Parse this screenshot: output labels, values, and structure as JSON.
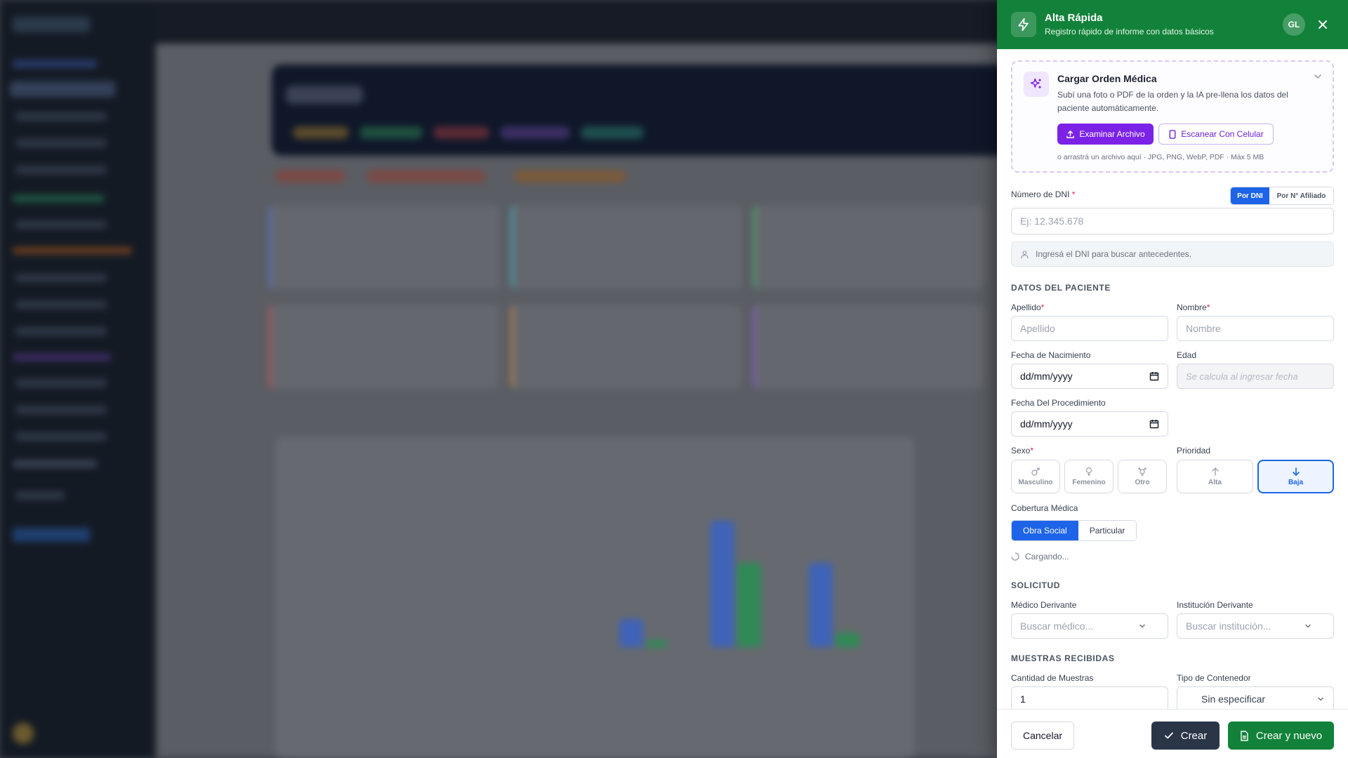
{
  "drawer": {
    "title": "Alta Rápida",
    "subtitle": "Registro rápido de informe con datos básicos",
    "avatar_initials": "GL",
    "accent_color": "#12823a"
  },
  "upload": {
    "title": "Cargar Orden Médica",
    "description": "Subí una foto o PDF de la orden y la IA pre-llena los datos del paciente automáticamente.",
    "browse_label": "Examinar Archivo",
    "scan_label": "Escanear Con Celular",
    "note": "o arrastrá un archivo aquí · JPG, PNG, WebP, PDF · Máx 5 MB"
  },
  "dni": {
    "label": "Número de DNI",
    "required_mark": "*",
    "placeholder": "Ej: 12.345.678",
    "mode_dni": "Por DNI",
    "mode_affiliate": "Por N° Afiliado",
    "hint": "Ingresá el DNI para buscar antecedentes."
  },
  "patient": {
    "section": "DATOS DEL PACIENTE",
    "last_name_label": "Apellido",
    "last_name_placeholder": "Apellido",
    "first_name_label": "Nombre",
    "first_name_placeholder": "Nombre",
    "birth_label": "Fecha de Nacimiento",
    "birth_value": "dd/mm/yyyy",
    "age_label": "Edad",
    "age_placeholder": "Se calcula al ingresar fecha",
    "procedure_label": "Fecha Del Procedimiento",
    "procedure_value": "dd/mm/yyyy",
    "sex_label": "Sexo",
    "sex_options": [
      "Masculino",
      "Femenino",
      "Otro"
    ],
    "priority_label": "Prioridad",
    "priority_options": [
      "Alta",
      "Baja"
    ],
    "priority_selected": "Baja",
    "coverage_label": "Cobertura Médica",
    "coverage_options": [
      "Obra Social",
      "Particular"
    ],
    "coverage_selected": "Obra Social",
    "loading": "Cargando..."
  },
  "request": {
    "section": "SOLICITUD",
    "doctor_label": "Médico Derivante",
    "doctor_placeholder": "Buscar médico...",
    "institution_label": "Institución Derivante",
    "institution_placeholder": "Buscar institución..."
  },
  "samples": {
    "section": "MUESTRAS RECIBIDAS",
    "quantity_label": "Cantidad de Muestras",
    "quantity_value": "1",
    "container_label": "Tipo de Contenedor",
    "container_value": "Sin especificar"
  },
  "footer": {
    "cancel": "Cancelar",
    "create": "Crear",
    "create_new": "Crear y nuevo"
  }
}
